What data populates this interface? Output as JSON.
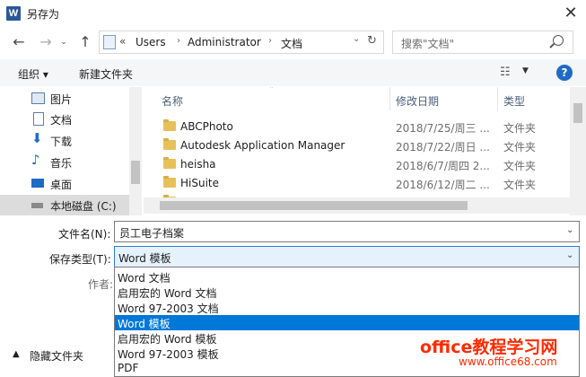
{
  "window": {
    "title": "另存为",
    "app_icon": "W"
  },
  "nav": {
    "back": "←",
    "forward": "→",
    "up": "↑",
    "addr_chev": "«",
    "breadcrumbs": [
      "Users",
      "Administrator",
      "文档"
    ],
    "refresh": "↻",
    "search_placeholder": "搜索\"文档\""
  },
  "toolbar": {
    "organize": "组织 ▾",
    "new_folder": "新建文件夹"
  },
  "sidebar": {
    "items": [
      {
        "label": "图片",
        "icon": "pictures-icon"
      },
      {
        "label": "文档",
        "icon": "documents-icon"
      },
      {
        "label": "下载",
        "icon": "downloads-icon"
      },
      {
        "label": "音乐",
        "icon": "music-icon"
      },
      {
        "label": "桌面",
        "icon": "desktop-icon"
      },
      {
        "label": "本地磁盘 (C:)",
        "icon": "drive-icon"
      }
    ]
  },
  "columns": {
    "name": "名称",
    "date": "修改日期",
    "type": "类型"
  },
  "files": [
    {
      "name": "ABCPhoto",
      "date": "2018/7/25/周三 ...",
      "type": "文件夹"
    },
    {
      "name": "Autodesk Application Manager",
      "date": "2018/7/22/周日 ...",
      "type": "文件夹"
    },
    {
      "name": "heisha",
      "date": "2018/6/7/周四 2...",
      "type": "文件夹"
    },
    {
      "name": "HiSuite",
      "date": "2018/6/12/周二 ...",
      "type": "文件夹"
    }
  ],
  "form": {
    "filename_label": "文件名(N):",
    "filename_value": "员工电子档案",
    "filetype_label": "保存类型(T):",
    "filetype_value": "Word 模板",
    "author_label": "作者:"
  },
  "filetype_options": [
    "Word 文档",
    "启用宏的 Word 文档",
    "Word 97-2003 文档",
    "Word 模板",
    "启用宏的 Word 模板",
    "Word 97-2003 模板",
    "PDF"
  ],
  "selected_option_index": 3,
  "footer": {
    "hide_folders": "隐藏文件夹"
  },
  "watermark": {
    "line1": "office教程学习网",
    "line2": "www.office68.com"
  },
  "colors": {
    "accent": "#0078d7",
    "folder": "#e8c05a",
    "watermark": "#ff2a00"
  }
}
